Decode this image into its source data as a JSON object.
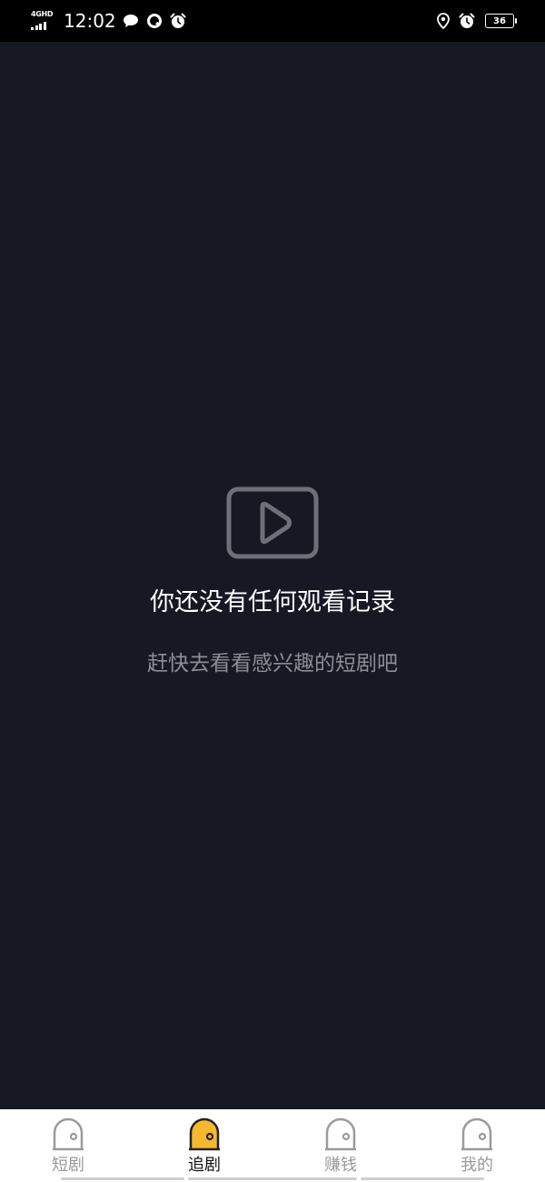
{
  "status_bar": {
    "network": "4GHD",
    "time": "12:02",
    "battery": "36",
    "icons": [
      "signal-icon",
      "message-icon",
      "q-app-icon",
      "alarm-icon",
      "location-icon",
      "alarm-icon",
      "battery-icon"
    ]
  },
  "empty_state": {
    "icon": "video-play-icon",
    "title": "你还没有任何观看记录",
    "subtitle": "赶快去看看感兴趣的短剧吧"
  },
  "tabs": [
    {
      "label": "短剧",
      "icon": "door-icon",
      "active": false
    },
    {
      "label": "追剧",
      "icon": "door-icon",
      "active": true
    },
    {
      "label": "赚钱",
      "icon": "door-icon",
      "active": false
    },
    {
      "label": "我的",
      "icon": "door-icon",
      "active": false
    }
  ],
  "colors": {
    "background": "#161824",
    "title_text": "#ffffff",
    "subtitle_text": "#8c8d95",
    "icon_gray": "#6e6f77",
    "tab_active_accent": "#f5b82e",
    "tab_inactive": "#9a9a9a"
  }
}
